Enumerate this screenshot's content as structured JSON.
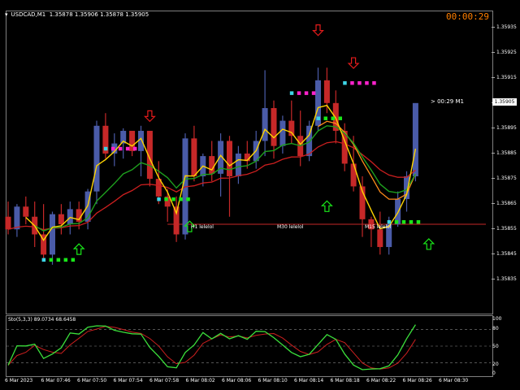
{
  "window": {
    "symbol": "USDCAD,M1",
    "ohlc": "1.35878 1.35906 1.35878 1.35905",
    "timer": "00:00:29"
  },
  "price_axis": {
    "labels": [
      "1.35935",
      "1.35925",
      "1.35915",
      "1.35905",
      "1.35895",
      "1.35885",
      "1.35875",
      "1.35865",
      "1.35855",
      "1.35845",
      "1.35835"
    ],
    "current": "1.35905"
  },
  "time_axis": {
    "labels": [
      "6 Mar 2023",
      "6 Mar 07:46",
      "6 Mar 07:50",
      "6 Mar 07:54",
      "6 Mar 07:58",
      "6 Mar 08:02",
      "6 Mar 08:06",
      "6 Mar 08:10",
      "6 Mar 08:14",
      "6 Mar 08:18",
      "6 Mar 08:22",
      "6 Mar 08:26",
      "6 Mar 08:30"
    ]
  },
  "countdown": "> 00:29 M1",
  "levels": [
    {
      "label": "H1 lelelol"
    },
    {
      "label": "M30 lelelol"
    },
    {
      "label": "M15 lelelol"
    }
  ],
  "oscillator": {
    "label": "Sto(5,3,3) 89.0734 68.6458",
    "levels": [
      "100",
      "80",
      "50",
      "20",
      "0"
    ]
  },
  "colors": {
    "bull": "#4a5ba8",
    "bear": "#c62828",
    "fast_ma": "#ffd400",
    "mid_ma": "#ff8c1a",
    "slow_ma": "#cc1f1f",
    "trend_ma": "#1e9e1e",
    "arrow_up": "#19e619",
    "arrow_down": "#e31b1b",
    "osc_main": "#3be03b",
    "osc_signal": "#cc1f1f"
  },
  "chart_data": {
    "type": "candlestick",
    "symbol": "USDCAD",
    "timeframe": "M1",
    "ylim": [
      1.3583,
      1.3594
    ],
    "candles": [
      {
        "o": 1.3586,
        "h": 1.35866,
        "l": 1.35853,
        "c": 1.35855
      },
      {
        "o": 1.35855,
        "h": 1.35865,
        "l": 1.35852,
        "c": 1.35864
      },
      {
        "o": 1.35864,
        "h": 1.35868,
        "l": 1.35857,
        "c": 1.3586
      },
      {
        "o": 1.3586,
        "h": 1.35866,
        "l": 1.35848,
        "c": 1.35853
      },
      {
        "o": 1.35853,
        "h": 1.35865,
        "l": 1.35843,
        "c": 1.35845
      },
      {
        "o": 1.35845,
        "h": 1.35862,
        "l": 1.35841,
        "c": 1.35861
      },
      {
        "o": 1.35861,
        "h": 1.35865,
        "l": 1.35853,
        "c": 1.35857
      },
      {
        "o": 1.35857,
        "h": 1.35866,
        "l": 1.35853,
        "c": 1.35863
      },
      {
        "o": 1.35863,
        "h": 1.35866,
        "l": 1.35855,
        "c": 1.35858
      },
      {
        "o": 1.35858,
        "h": 1.35871,
        "l": 1.35855,
        "c": 1.3587
      },
      {
        "o": 1.3587,
        "h": 1.35898,
        "l": 1.35865,
        "c": 1.35896
      },
      {
        "o": 1.35896,
        "h": 1.35901,
        "l": 1.35883,
        "c": 1.35885
      },
      {
        "o": 1.35885,
        "h": 1.35893,
        "l": 1.3588,
        "c": 1.35889
      },
      {
        "o": 1.35889,
        "h": 1.35895,
        "l": 1.35883,
        "c": 1.35894
      },
      {
        "o": 1.35894,
        "h": 1.35894,
        "l": 1.35884,
        "c": 1.35886
      },
      {
        "o": 1.35886,
        "h": 1.35896,
        "l": 1.35876,
        "c": 1.35894
      },
      {
        "o": 1.35894,
        "h": 1.35894,
        "l": 1.35872,
        "c": 1.35875
      },
      {
        "o": 1.35875,
        "h": 1.35882,
        "l": 1.35865,
        "c": 1.35868
      },
      {
        "o": 1.35868,
        "h": 1.35871,
        "l": 1.35858,
        "c": 1.35864
      },
      {
        "o": 1.35864,
        "h": 1.35868,
        "l": 1.3585,
        "c": 1.35853
      },
      {
        "o": 1.35853,
        "h": 1.35893,
        "l": 1.35851,
        "c": 1.35891
      },
      {
        "o": 1.35891,
        "h": 1.35896,
        "l": 1.35874,
        "c": 1.35876
      },
      {
        "o": 1.35876,
        "h": 1.35885,
        "l": 1.35872,
        "c": 1.35884
      },
      {
        "o": 1.35884,
        "h": 1.3589,
        "l": 1.35874,
        "c": 1.35877
      },
      {
        "o": 1.35877,
        "h": 1.35893,
        "l": 1.35868,
        "c": 1.3589
      },
      {
        "o": 1.3589,
        "h": 1.35892,
        "l": 1.3586,
        "c": 1.35876
      },
      {
        "o": 1.35876,
        "h": 1.35888,
        "l": 1.35873,
        "c": 1.35885
      },
      {
        "o": 1.35885,
        "h": 1.3589,
        "l": 1.35879,
        "c": 1.35882
      },
      {
        "o": 1.35882,
        "h": 1.35894,
        "l": 1.35879,
        "c": 1.3589
      },
      {
        "o": 1.3589,
        "h": 1.35918,
        "l": 1.35884,
        "c": 1.35903
      },
      {
        "o": 1.35903,
        "h": 1.35906,
        "l": 1.35883,
        "c": 1.35888
      },
      {
        "o": 1.35888,
        "h": 1.359,
        "l": 1.35885,
        "c": 1.35898
      },
      {
        "o": 1.35898,
        "h": 1.35906,
        "l": 1.35889,
        "c": 1.35892
      },
      {
        "o": 1.35892,
        "h": 1.35902,
        "l": 1.3588,
        "c": 1.35884
      },
      {
        "o": 1.35884,
        "h": 1.35898,
        "l": 1.35882,
        "c": 1.35896
      },
      {
        "o": 1.35896,
        "h": 1.35919,
        "l": 1.35894,
        "c": 1.35914
      },
      {
        "o": 1.35914,
        "h": 1.35919,
        "l": 1.35901,
        "c": 1.35905
      },
      {
        "o": 1.35905,
        "h": 1.3591,
        "l": 1.35889,
        "c": 1.35894
      },
      {
        "o": 1.35894,
        "h": 1.35897,
        "l": 1.35878,
        "c": 1.35881
      },
      {
        "o": 1.35881,
        "h": 1.35892,
        "l": 1.3587,
        "c": 1.35872
      },
      {
        "o": 1.35872,
        "h": 1.35876,
        "l": 1.35852,
        "c": 1.35859
      },
      {
        "o": 1.35859,
        "h": 1.3586,
        "l": 1.35848,
        "c": 1.35855
      },
      {
        "o": 1.35855,
        "h": 1.35862,
        "l": 1.35845,
        "c": 1.35848
      },
      {
        "o": 1.35848,
        "h": 1.3586,
        "l": 1.35845,
        "c": 1.35857
      },
      {
        "o": 1.35857,
        "h": 1.3587,
        "l": 1.35856,
        "c": 1.35867
      },
      {
        "o": 1.35867,
        "h": 1.35878,
        "l": 1.35862,
        "c": 1.35876
      },
      {
        "o": 1.35876,
        "h": 1.35904,
        "l": 1.35874,
        "c": 1.35905
      }
    ]
  }
}
